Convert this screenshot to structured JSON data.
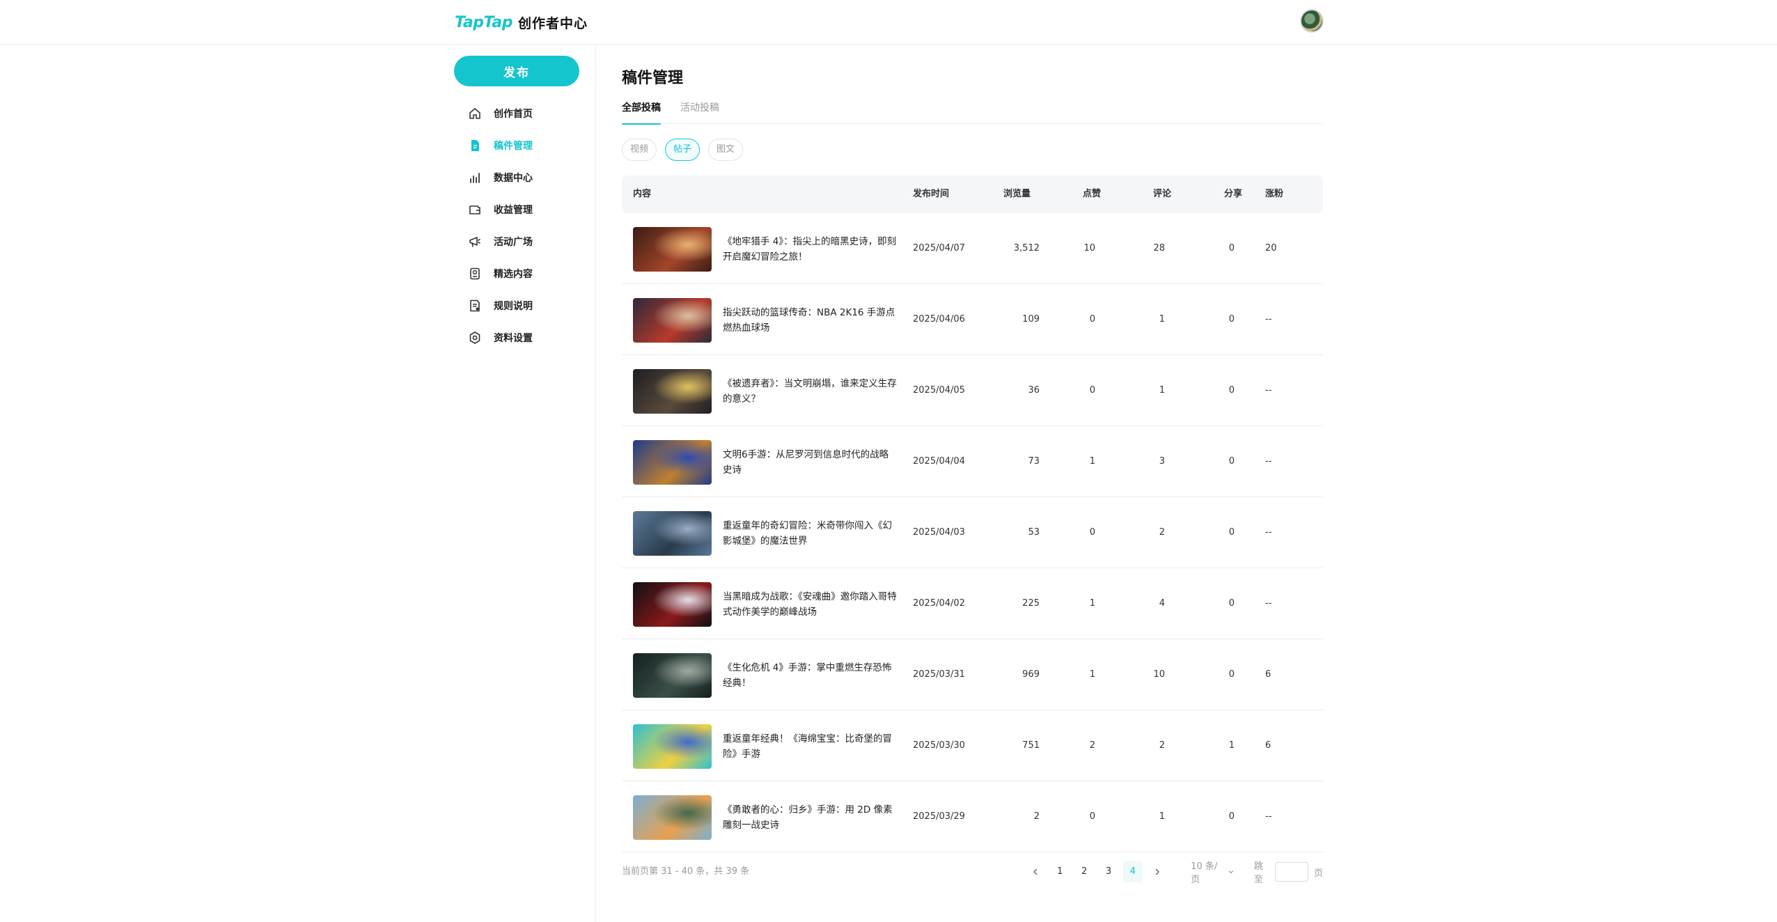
{
  "header": {
    "logo_mark": "TapTap",
    "logo_sub": "创作者中心",
    "avatar": "avatar-globe"
  },
  "sidebar": {
    "publish_label": "发布",
    "items": [
      {
        "label": "创作首页",
        "icon": "home-icon"
      },
      {
        "label": "稿件管理",
        "icon": "document-icon",
        "active": true
      },
      {
        "label": "数据中心",
        "icon": "bar-chart-icon"
      },
      {
        "label": "收益管理",
        "icon": "wallet-icon"
      },
      {
        "label": "活动广场",
        "icon": "megaphone-icon"
      },
      {
        "label": "精选内容",
        "icon": "featured-icon"
      },
      {
        "label": "规则说明",
        "icon": "rules-icon"
      },
      {
        "label": "资料设置",
        "icon": "settings-icon"
      }
    ]
  },
  "main": {
    "title": "稿件管理",
    "tabs": [
      {
        "label": "全部投稿",
        "active": true
      },
      {
        "label": "活动投稿",
        "active": false
      }
    ],
    "chips": [
      {
        "label": "视频",
        "active": false
      },
      {
        "label": "帖子",
        "active": true
      },
      {
        "label": "图文",
        "active": false
      }
    ],
    "columns": {
      "content": "内容",
      "date": "发布时间",
      "views": "浏览量",
      "likes": "点赞",
      "comments": "评论",
      "shares": "分享",
      "fans": "涨粉"
    },
    "rows": [
      {
        "title": "《地牢猎手 4》：指尖上的暗黑史诗，即刻开启魔幻冒险之旅！",
        "date": "2025/04/07",
        "views": "3,512",
        "likes": "10",
        "comments": "28",
        "shares": "0",
        "fans": "20"
      },
      {
        "title": "指尖跃动的篮球传奇：NBA 2K16 手游点燃热血球场",
        "date": "2025/04/06",
        "views": "109",
        "likes": "0",
        "comments": "1",
        "shares": "0",
        "fans": "--"
      },
      {
        "title": "《被遗弃者》：当文明崩塌，谁来定义生存的意义？",
        "date": "2025/04/05",
        "views": "36",
        "likes": "0",
        "comments": "1",
        "shares": "0",
        "fans": "--"
      },
      {
        "title": "文明6手游：从尼罗河到信息时代的战略史诗",
        "date": "2025/04/04",
        "views": "73",
        "likes": "1",
        "comments": "3",
        "shares": "0",
        "fans": "--"
      },
      {
        "title": "重返童年的奇幻冒险：米奇带你闯入《幻影城堡》的魔法世界",
        "date": "2025/04/03",
        "views": "53",
        "likes": "0",
        "comments": "2",
        "shares": "0",
        "fans": "--"
      },
      {
        "title": "当黑暗成为战歌：《安魂曲》邀你踏入哥特式动作美学的巅峰战场",
        "date": "2025/04/02",
        "views": "225",
        "likes": "1",
        "comments": "4",
        "shares": "0",
        "fans": "--"
      },
      {
        "title": "《生化危机 4》手游：掌中重燃生存恐怖经典！",
        "date": "2025/03/31",
        "views": "969",
        "likes": "1",
        "comments": "10",
        "shares": "0",
        "fans": "6"
      },
      {
        "title": "重返童年经典！《海绵宝宝：比奇堡的冒险》手游",
        "date": "2025/03/30",
        "views": "751",
        "likes": "2",
        "comments": "2",
        "shares": "1",
        "fans": "6"
      },
      {
        "title": "《勇敢者的心：归乡》手游：用 2D 像素雕刻一战史诗",
        "date": "2025/03/29",
        "views": "2",
        "likes": "0",
        "comments": "1",
        "shares": "0",
        "fans": "--"
      }
    ],
    "thumb_colors": [
      [
        "#3a1d14",
        "#a3452a",
        "#e8b070"
      ],
      [
        "#2a2a3a",
        "#b83a2a",
        "#d8c0a0"
      ],
      [
        "#1e1e24",
        "#5a4a3a",
        "#e0c060"
      ],
      [
        "#1e3c8a",
        "#c08030",
        "#2a4ab0"
      ],
      [
        "#5a7a9a",
        "#2a3a4a",
        "#9ab0c8"
      ],
      [
        "#101014",
        "#8a1a1a",
        "#e0e0e8"
      ],
      [
        "#142020",
        "#3a5048",
        "#a0a8a0"
      ],
      [
        "#30c0d0",
        "#f0d040",
        "#3a6ad0"
      ],
      [
        "#7ab0d0",
        "#e8a050",
        "#406a50"
      ]
    ]
  },
  "pagination": {
    "total_text": "当前页第 31 - 40 条，共 39 条",
    "pages": [
      "1",
      "2",
      "3",
      "4"
    ],
    "active_page": "4",
    "page_size": "10 条/页",
    "jump_label": "跳至",
    "jump_suffix": "页"
  }
}
